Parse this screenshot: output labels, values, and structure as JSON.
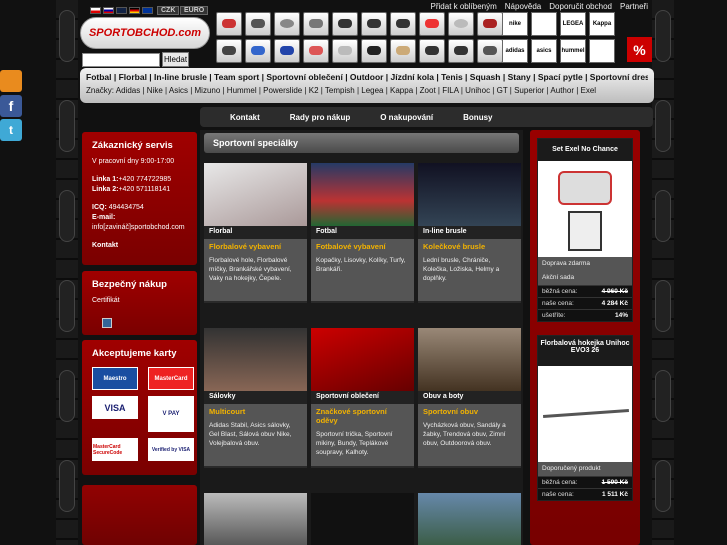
{
  "header": {
    "currency": [
      "CZK",
      "EURO"
    ],
    "top_links": [
      "Přidat k oblíbeným",
      "Nápověda",
      "Doporučit obchod",
      "Partneři"
    ],
    "logo_text": "SPORTOBCHOD.com",
    "search": {
      "placeholder": "",
      "button": "Hledat"
    },
    "promo_badge": "%"
  },
  "brands_row": [
    "nike",
    "",
    "LEGEA",
    "Kappa",
    "adidas",
    "asics",
    "hummel",
    ""
  ],
  "category_bar": {
    "categories": "Fotbal | Florbal | In-line brusle | Team sport | Sportovní oblečení | Outdoor | Jízdní kola | Tenis | Squash | Stany | Spací pytle | Sportovní dresy",
    "brands": "Značky: Adidas | Nike | Asics | Mizuno | Hummel | Powerslide | K2 | Tempish | Legea | Kappa | Zoot | FILA | Unihoc | GT | Superior | Author | Exel"
  },
  "nav": [
    "Kontakt",
    "Rady pro nákup",
    "O nakupování",
    "Bonusy"
  ],
  "service": {
    "title": "Zákaznický servis",
    "hours": "V pracovní dny 9:00-17:00",
    "line1_label": "Linka 1:",
    "line1": "+420 774722985",
    "line2_label": "Linka 2:",
    "line2": "+420 571118141",
    "ico_label": "ICQ:",
    "ico": "494434754",
    "email_label": "E-mail:",
    "email": "info[zavináč]sportobchod.com",
    "contact": "Kontakt"
  },
  "safe": {
    "title": "Bezpečný nákup",
    "cert": "Certifikát"
  },
  "cards": {
    "title": "Akceptujeme karty",
    "list": [
      "Maestro",
      "MasterCard",
      "VISA",
      "V PAY",
      "MasterCard SecureCode",
      "Verified by VISA"
    ]
  },
  "main": {
    "title": "Sportovní speciálky",
    "tiles": [
      {
        "cat": "Florbal",
        "title": "Florbalové vybavení",
        "desc": "Florbalové hole, Florbalové míčky, Brankářské vybavení, Vaky na hokejky, Čepele."
      },
      {
        "cat": "Fotbal",
        "title": "Fotbalové vybavení",
        "desc": "Kopačky, Lisovky, Kolíky, Turfy, Brankáři."
      },
      {
        "cat": "In-line brusle",
        "title": "Kolečkové brusle",
        "desc": "Lední brusle, Chrániče, Kolečka, Ložiska, Helmy a doplňky."
      },
      {
        "cat": "Sálovky",
        "title": "Multicourt",
        "desc": "Adidas Stabil, Asics sálovky, Gel Blast, Sálová obuv Nike, Volejbalová obuv."
      },
      {
        "cat": "Sportovní oblečení",
        "title": "Značkové sportovní oděvy",
        "desc": "Sportovní trička, Sportovní mikiny, Bundy, Teplákové soupravy, Kalhoty."
      },
      {
        "cat": "Obuv a boty",
        "title": "Sportovní obuv",
        "desc": "Vycházková obuv, Sandály a žabky, Trendová obuv, Zimní obuv, Outdoorová obuv."
      }
    ]
  },
  "products": [
    {
      "name": "Set Exel No Chance",
      "tags": [
        "Doprava zdarma",
        "Akční sada"
      ],
      "price_label": "běžná cena:",
      "price": "4 960 Kč",
      "our_label": "naše cena:",
      "our": "4 284 Kč",
      "save_label": "ušetříte:",
      "save": "14%"
    },
    {
      "name": "Florbalová hokejka Unihoc EVO3 26",
      "tags": [
        "Doporučený produkt"
      ],
      "price_label": "běžná cena:",
      "price": "1 590 Kč",
      "our_label": "naše cena:",
      "our": "1 511 Kč"
    }
  ],
  "colors": {
    "accent": "#c00000",
    "panel": "#8a0000",
    "gold": "#f2b200"
  }
}
